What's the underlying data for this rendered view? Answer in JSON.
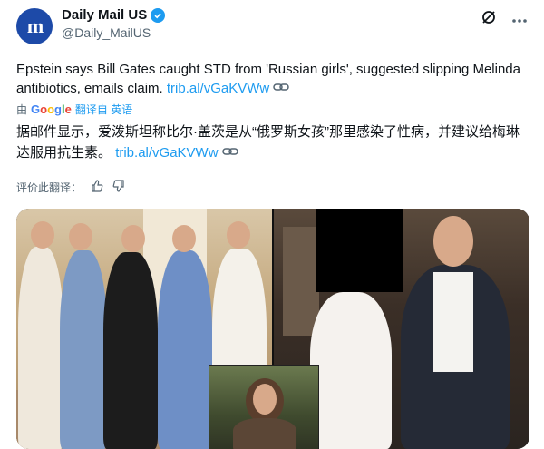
{
  "account": {
    "avatar_letters": "m",
    "name": "Daily Mail US",
    "handle": "@Daily_MailUS"
  },
  "header_icons": [
    "grok-icon",
    "more-icon"
  ],
  "tweet": {
    "text": "Epstein says Bill Gates caught STD from 'Russian girls', suggested slipping Melinda antibiotics, emails claim.",
    "link": "trib.al/vGaKVWw"
  },
  "translation": {
    "by": "由",
    "google": "Google",
    "translated_from": "翻译自 英语",
    "text": "据邮件显示，爱泼斯坦称比尔·盖茨是从“俄罗斯女孩”那里感染了性病，并建议给梅琳达服用抗生素。",
    "link": "trib.al/vGaKVWw",
    "rate_label": "评价此翻译："
  },
  "colors": {
    "link": "#1d9bf0",
    "verified": "#1d9bf0",
    "muted": "#536471",
    "avatar_bg": "#1d4aa8"
  }
}
